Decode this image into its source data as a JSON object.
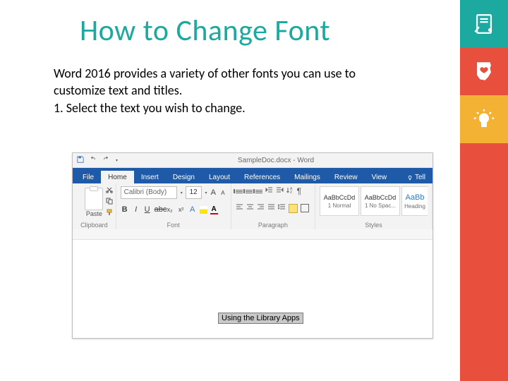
{
  "slide": {
    "title": "How to Change Font",
    "body_line1": "Word 2016 provides a variety of other fonts you can use to customize text and titles.",
    "body_line2": "1.  Select the text you wish to change."
  },
  "word": {
    "title_center": "SampleDoc.docx - Word",
    "tabs": {
      "file": "File",
      "home": "Home",
      "insert": "Insert",
      "design": "Design",
      "layout": "Layout",
      "references": "References",
      "mailings": "Mailings",
      "review": "Review",
      "view": "View",
      "tell": "Tell"
    },
    "groups": {
      "clipboard": {
        "label": "Clipboard",
        "paste": "Paste"
      },
      "font": {
        "label": "Font",
        "name": "Calibri (Body)",
        "size": "12"
      },
      "paragraph": {
        "label": "Paragraph"
      },
      "styles": {
        "label": "Styles",
        "sample": "AaBbCcDd",
        "sample_short": "AaBb",
        "names": [
          "1 Normal",
          "1 No Spac...",
          "Heading"
        ]
      }
    },
    "selected_text": "Using the Library Apps"
  }
}
